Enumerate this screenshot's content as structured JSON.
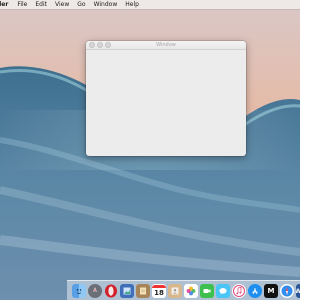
{
  "menubar": {
    "app_name": "Finder",
    "visible_app_name": "der",
    "items": [
      "File",
      "Edit",
      "View",
      "Go",
      "Window",
      "Help"
    ]
  },
  "window": {
    "title": "Window"
  },
  "dock": {
    "apps": [
      {
        "name": "Finder",
        "icon": "finder-icon"
      },
      {
        "name": "Launchpad",
        "icon": "rocket-icon"
      },
      {
        "name": "Opera",
        "icon": "opera-icon"
      },
      {
        "name": "Preview",
        "icon": "preview-icon"
      },
      {
        "name": "Notes",
        "icon": "notes-icon"
      },
      {
        "name": "Calendar",
        "icon": "calendar-icon",
        "date": "18"
      },
      {
        "name": "Contacts",
        "icon": "contacts-icon"
      },
      {
        "name": "Photos",
        "icon": "photos-icon"
      },
      {
        "name": "FaceTime",
        "icon": "facetime-icon"
      },
      {
        "name": "Messages",
        "icon": "messages-icon"
      },
      {
        "name": "Music",
        "icon": "music-icon"
      },
      {
        "name": "App Store",
        "icon": "app-store-icon"
      },
      {
        "name": "Medium",
        "icon": "medium-icon",
        "letter": "M"
      },
      {
        "name": "Safari",
        "icon": "safari-icon"
      },
      {
        "name": "Word",
        "icon": "word-icon",
        "letter": "W"
      }
    ]
  }
}
